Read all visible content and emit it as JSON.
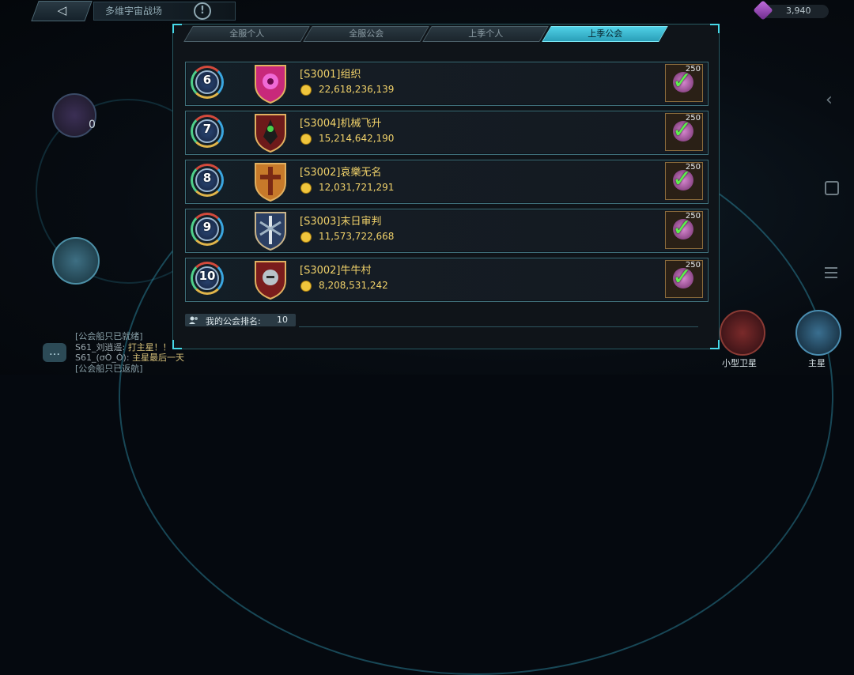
{
  "header": {
    "back_label": "◁",
    "title": "多维宇宙战场",
    "resource_value": "3,940"
  },
  "tabs": [
    {
      "label": "全服个人",
      "active": false
    },
    {
      "label": "全服公会",
      "active": false
    },
    {
      "label": "上季个人",
      "active": false
    },
    {
      "label": "上季公会",
      "active": true
    }
  ],
  "rankings": [
    {
      "rank": "6",
      "name": "[S3001]组织",
      "score": "22,618,236,139",
      "reward_qty": "250",
      "claimed": true,
      "shield_color": "#c8297a"
    },
    {
      "rank": "7",
      "name": "[S3004]机械飞升",
      "score": "15,214,642,190",
      "reward_qty": "250",
      "claimed": true,
      "shield_color": "#6d1a1a"
    },
    {
      "rank": "8",
      "name": "[S3002]哀樂无名",
      "score": "12,031,721,291",
      "reward_qty": "250",
      "claimed": true,
      "shield_color": "#c77a2a"
    },
    {
      "rank": "9",
      "name": "[S3003]末日审判",
      "score": "11,573,722,668",
      "reward_qty": "250",
      "claimed": true,
      "shield_color": "#2b3f63"
    },
    {
      "rank": "10",
      "name": "[S3002]牛牛村",
      "score": "8,208,531,242",
      "reward_qty": "250",
      "claimed": true,
      "shield_color": "#7a1c1c"
    }
  ],
  "footer": {
    "my_rank_label": "我的公会排名:",
    "my_rank_value": "10"
  },
  "left": {
    "count": "0"
  },
  "chat": {
    "lines": [
      {
        "text": "[公会船只已就绪]"
      },
      {
        "prefix": "S61_刘逍遥:",
        "text": "打主星！！"
      },
      {
        "prefix": "S61_(σÒ_Ó):",
        "text": "主星最后一天"
      },
      {
        "text": "[公会船只已返航]"
      }
    ]
  },
  "bottom_right": {
    "small_satellite_label": "小型卫星",
    "main_planet_label": "主星"
  }
}
